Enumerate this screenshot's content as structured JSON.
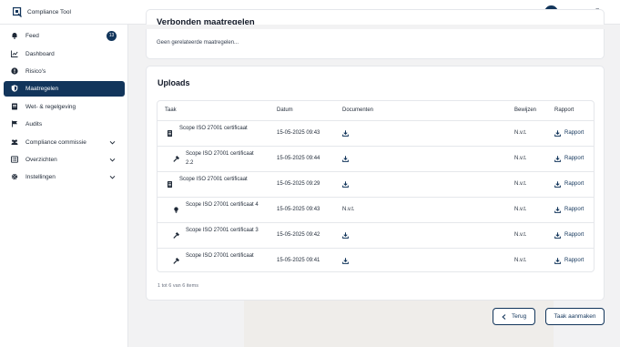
{
  "app": {
    "title": "Compliance Tool"
  },
  "colors": {
    "primary": "#12355b",
    "background": "#f2f2f3"
  },
  "sidebar": {
    "items": [
      {
        "label": "Feed",
        "icon": "bell-icon",
        "badge": "13"
      },
      {
        "label": "Dashboard",
        "icon": "chart-icon"
      },
      {
        "label": "Risico's",
        "icon": "alert-icon"
      },
      {
        "label": "Maatregelen",
        "icon": "shield-icon",
        "active": true
      },
      {
        "label": "Wet- & regelgeving",
        "icon": "book-icon"
      },
      {
        "label": "Audits",
        "icon": "flag-icon"
      },
      {
        "label": "Compliance commissie",
        "icon": "group-icon",
        "expandable": true
      },
      {
        "label": "Overzichten",
        "icon": "list-icon",
        "expandable": true
      },
      {
        "label": "Instellingen",
        "icon": "gear-icon",
        "expandable": true
      }
    ]
  },
  "related": {
    "title": "Verbonden maatregelen",
    "empty_text": "Geen gerelateerde maatregelen..."
  },
  "uploads": {
    "title": "Uploads",
    "columns": [
      "Taak",
      "Datum",
      "Documenten",
      "Bewijzen",
      "Rapport"
    ],
    "rows": [
      {
        "task": "Scope ISO 27001 certificaat",
        "task_icon": "document-icon",
        "date": "15-05-2025 09:43",
        "documents": "download-icon",
        "evidence": "N.v.t.",
        "report": "Rapport"
      },
      {
        "task": "Scope ISO 27001 certificaat 2.2",
        "task_icon": "hammer-icon",
        "date": "15-05-2025 09:44",
        "documents": "download-icon",
        "evidence": "N.v.t.",
        "report": "Rapport"
      },
      {
        "task": "Scope ISO 27001 certificaat",
        "task_icon": "document-icon",
        "date": "15-05-2025 09:29",
        "documents": "download-icon",
        "evidence": "N.v.t.",
        "report": "Rapport"
      },
      {
        "task": "Scope ISO 27001 certificaat 4",
        "task_icon": "lightbulb-icon",
        "date": "15-05-2025 09:43",
        "documents": "N.v.t.",
        "evidence": "N.v.t.",
        "report": "Rapport"
      },
      {
        "task": "Scope ISO 27001 certificaat 3",
        "task_icon": "hammer-icon",
        "date": "15-05-2025 09:42",
        "documents": "download-icon",
        "evidence": "N.v.t.",
        "report": "Rapport"
      },
      {
        "task": "Scope ISO 27001 certificaat",
        "task_icon": "hammer-icon",
        "date": "15-05-2025 09:41",
        "documents": "download-icon",
        "evidence": "N.v.t.",
        "report": "Rapport"
      }
    ],
    "pagination": "1 tot 6 van 6 items"
  },
  "actions": {
    "back_label": "Terug",
    "create_label": "Taak aanmaken"
  }
}
